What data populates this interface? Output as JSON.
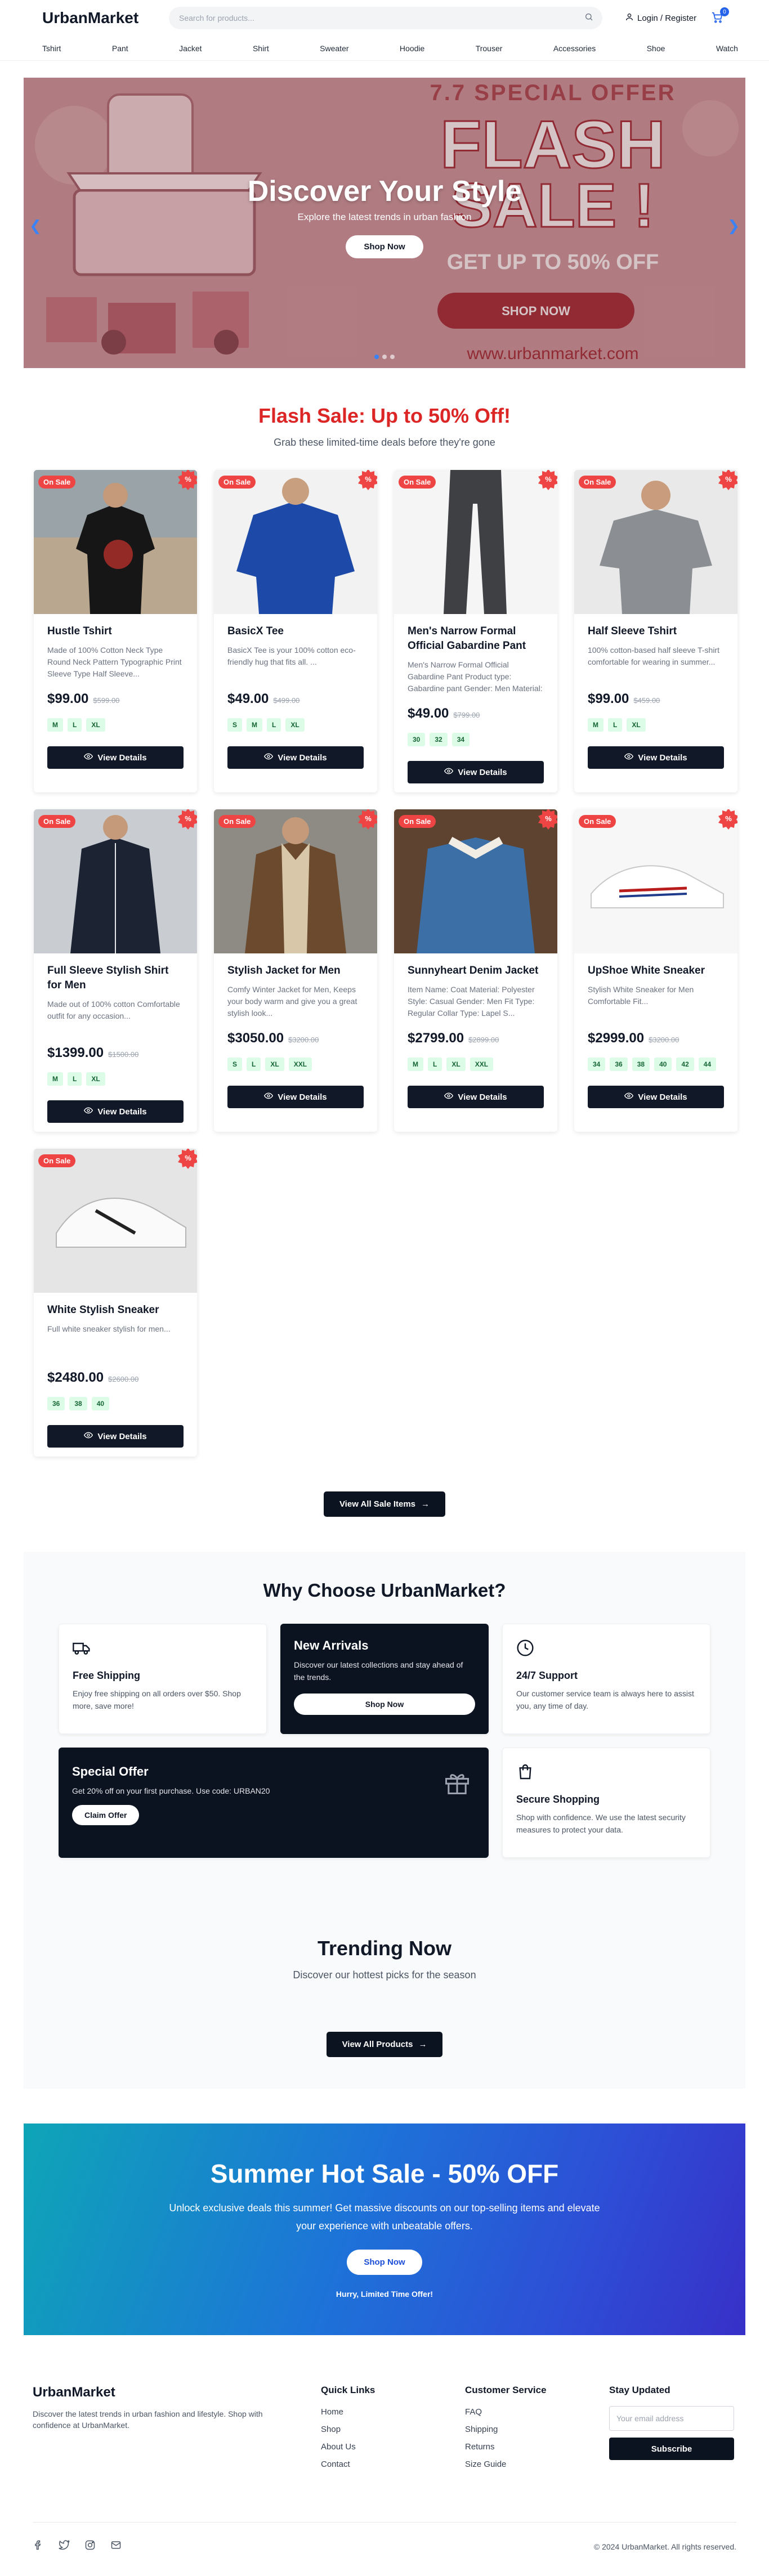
{
  "header": {
    "logo": "UrbanMarket",
    "search_placeholder": "Search for products...",
    "login_label": "Login / Register",
    "cart_count": "0"
  },
  "nav": [
    "Tshirt",
    "Pant",
    "Jacket",
    "Shirt",
    "Sweater",
    "Hoodie",
    "Trouser",
    "Accessories",
    "Shoe",
    "Watch"
  ],
  "hero": {
    "title": "Discover Your Style",
    "subtitle": "Explore the latest trends in urban fashion",
    "button": "Shop Now",
    "banner": {
      "offer": "7.7 SPECIAL OFFER",
      "flash": "FLASH",
      "sale": "SALE !",
      "upto": "GET UP TO 50% OFF",
      "shop": "SHOP NOW",
      "url": "www.urbanmarket.com"
    }
  },
  "flash": {
    "title": "Flash Sale: Up to 50% Off!",
    "subtitle": "Grab these limited-time deals before they're gone",
    "badge": "On Sale",
    "view_label": "View Details",
    "products": [
      {
        "title": "Hustle Tshirt",
        "desc": "Made of 100% Cotton Neck Type Round Neck Pattern Typographic Print Sleeve Type Half Sleeve...",
        "price": "$99.00",
        "old": "$599.00",
        "sizes": [
          "M",
          "L",
          "XL"
        ],
        "img": "tshirt-black"
      },
      {
        "title": "BasicX Tee",
        "desc": "BasicX Tee is your 100% cotton eco-friendly hug that fits all. ...",
        "price": "$49.00",
        "old": "$499.00",
        "sizes": [
          "S",
          "M",
          "L",
          "XL"
        ],
        "img": "tee-blue"
      },
      {
        "title": "Men's Narrow Formal Official Gabardine Pant",
        "desc": "Men's Narrow Formal Official Gabardine Pant Product type: Gabardine pant Gender: Men Material: Cotto...",
        "price": "$49.00",
        "old": "$799.00",
        "sizes": [
          "30",
          "32",
          "34"
        ],
        "img": "pant-grey"
      },
      {
        "title": "Half Sleeve Tshirt",
        "desc": "100% cotton-based half sleeve T-shirt comfortable for wearing in summer...",
        "price": "$99.00",
        "old": "$459.00",
        "sizes": [
          "M",
          "L",
          "XL"
        ],
        "img": "tshirt-grey"
      },
      {
        "title": "Full Sleeve Stylish Shirt for Men",
        "desc": "Made out of 100% cotton Comfortable outfit for any occasion...",
        "price": "$1399.00",
        "old": "$1500.00",
        "sizes": [
          "M",
          "L",
          "XL"
        ],
        "img": "shirt-navy"
      },
      {
        "title": "Stylish Jacket for Men",
        "desc": "Comfy Winter Jacket for Men, Keeps your body warm and give you a great stylish look...",
        "price": "$3050.00",
        "old": "$3200.00",
        "sizes": [
          "S",
          "L",
          "XL",
          "XXL"
        ],
        "img": "jacket-brown"
      },
      {
        "title": "Sunnyheart Denim Jacket",
        "desc": "Item Name: Coat Material: Polyester Style: Casual Gender: Men Fit Type: Regular Collar Type: Lapel S...",
        "price": "$2799.00",
        "old": "$2899.00",
        "sizes": [
          "M",
          "L",
          "XL",
          "XXL"
        ],
        "img": "denim"
      },
      {
        "title": "UpShoe White Sneaker",
        "desc": "Stylish White Sneaker for Men Comfortable Fit...",
        "price": "$2999.00",
        "old": "$3200.00",
        "sizes": [
          "34",
          "36",
          "38",
          "40",
          "42",
          "44"
        ],
        "img": "sneaker-red"
      },
      {
        "title": "White Stylish Sneaker",
        "desc": "Full white sneaker stylish for men...",
        "price": "$2480.00",
        "old": "$2600.00",
        "sizes": [
          "36",
          "38",
          "40"
        ],
        "img": "sneaker-white"
      }
    ],
    "view_all": "View All Sale Items"
  },
  "why": {
    "title": "Why Choose UrbanMarket?",
    "shipping": {
      "title": "Free Shipping",
      "desc": "Enjoy free shipping on all orders over $50. Shop more, save more!",
      "icon": "truck-icon"
    },
    "arrivals": {
      "title": "New Arrivals",
      "desc": "Discover our latest collections and stay ahead of the trends.",
      "button": "Shop Now"
    },
    "support": {
      "title": "24/7 Support",
      "desc": "Our customer service team is always here to assist you, any time of day.",
      "icon": "clock-icon"
    },
    "offer": {
      "title": "Special Offer",
      "desc": "Get 20% off on your first purchase. Use code: URBAN20",
      "button": "Claim Offer",
      "icon": "gift-icon"
    },
    "secure": {
      "title": "Secure Shopping",
      "desc": "Shop with confidence. We use the latest security measures to protect your data.",
      "icon": "bag-icon"
    }
  },
  "trending": {
    "title": "Trending Now",
    "subtitle": "Discover our hottest picks for the season",
    "button": "View All Products"
  },
  "summer": {
    "title": "Summer Hot Sale - 50% OFF",
    "desc": "Unlock exclusive deals this summer! Get massive discounts on our top-selling items and elevate your experience with unbeatable offers.",
    "button": "Shop Now",
    "hurry": "Hurry, Limited Time Offer!"
  },
  "footer": {
    "brand": "UrbanMarket",
    "about": "Discover the latest trends in urban fashion and lifestyle. Shop with confidence at UrbanMarket.",
    "quick_title": "Quick Links",
    "quick": [
      "Home",
      "Shop",
      "About Us",
      "Contact"
    ],
    "service_title": "Customer Service",
    "service": [
      "FAQ",
      "Shipping",
      "Returns",
      "Size Guide"
    ],
    "updated_title": "Stay Updated",
    "email_placeholder": "Your email address",
    "subscribe": "Subscribe",
    "copyright": "© 2024 UrbanMarket. All rights reserved.",
    "socials": [
      "facebook-icon",
      "twitter-icon",
      "instagram-icon",
      "mail-icon"
    ]
  },
  "colors": {
    "accent": "#dc2626",
    "dark": "#0b1220",
    "blue": "#2563eb",
    "size_bg": "#dcfce7"
  }
}
